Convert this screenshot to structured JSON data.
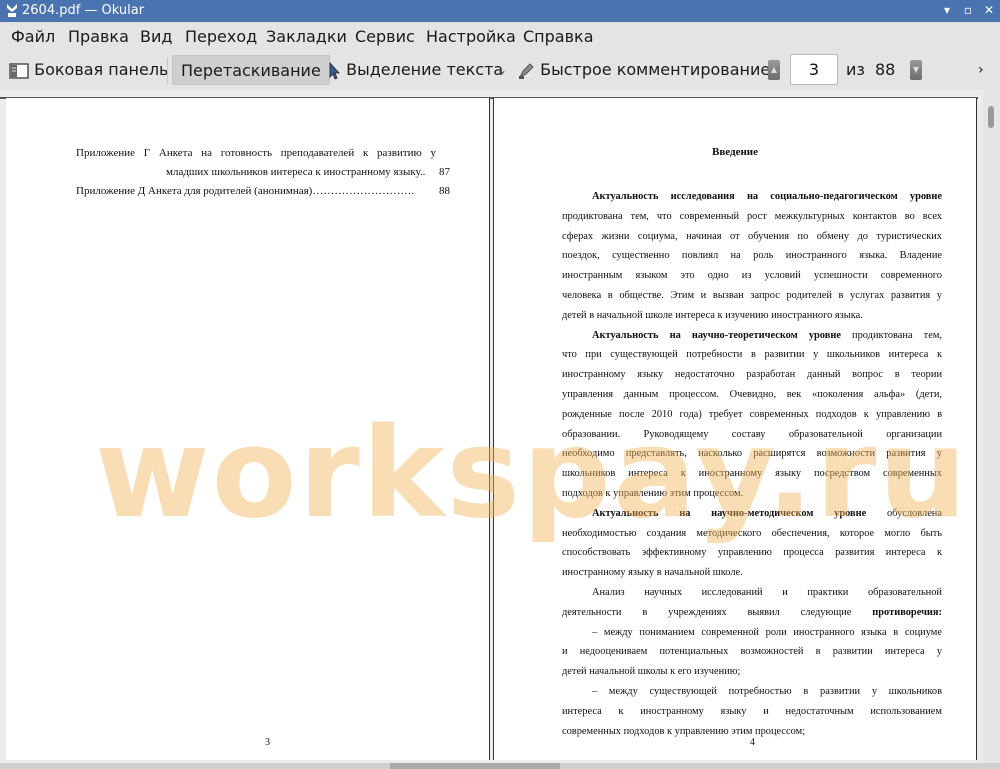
{
  "window": {
    "title": "2604.pdf — Okular"
  },
  "menu": [
    "Файл",
    "Правка",
    "Вид",
    "Переход",
    "Закладки",
    "Сервис",
    "Настройка",
    "Справка"
  ],
  "toolbar": {
    "sidebar_label": "Боковая панель",
    "drag_label": "Перетаскивание",
    "select_label": "Выделение текста",
    "annotate_label": "Быстрое комментирование",
    "page_current": "3",
    "of_label": "из",
    "page_total": "88"
  },
  "left_page": {
    "toc": [
      {
        "line1": "Приложение Г Анкета на готовность преподавателей к развитию у",
        "line2": "младших школьников интереса к иностранному языку..",
        "page": "87"
      },
      {
        "line1": "Приложение Д Анкета для родителей (анонимная)……………………….",
        "page": "88"
      }
    ],
    "page_number": "3"
  },
  "right_page": {
    "heading": "Введение",
    "lines": [
      {
        "bold": "Актуальность исследования на социально-педагогическом уровне",
        "text": ""
      },
      {
        "text": "продиктована тем, что современный рост межкультурных контактов во всех"
      },
      {
        "text": "сферах жизни социума, начиная от обучения по обмену до туристических"
      },
      {
        "text": "поездок, существенно повлиял на роль иностранного языка. Владение"
      },
      {
        "text": "иностранным языком это одно из условий успешности современного"
      },
      {
        "text": "человека в обществе. Этим и вызван запрос родителей в услугах развития у"
      },
      {
        "text": "детей в начальной школе интереса к изучению иностранного языка."
      },
      {
        "bold": "Актуальность на научно-теоретическом уровне",
        "text": " продиктована тем,"
      },
      {
        "text": "что при существующей потребности в развитии у школьников интереса к"
      },
      {
        "text": "иностранному языку недостаточно разработан данный вопрос в теории"
      },
      {
        "text": "управления данным процессом. Очевидно, век «поколения альфа» (дети,"
      },
      {
        "text": "рожденные после 2010 года) требует современных подходов к управлению в"
      },
      {
        "text": "образовании. Руководящему составу образовательной организации"
      },
      {
        "text": "необходимо представлять, насколько расширятся возможности развития у"
      },
      {
        "text": "школьников интереса к иностранному языку посредством современных"
      },
      {
        "text": "подходов к управлению этим процессом."
      },
      {
        "bold": "Актуальность на научно-методическом уровне",
        "text": " обусловлена"
      },
      {
        "text": "необходимостью создания методического обеспечения, которое могло быть"
      },
      {
        "text": "способствовать эффективному управлению процесса развития интереса к"
      },
      {
        "text": "иностранному языку в начальной школе."
      },
      {
        "text": "Анализ научных исследований и практики образовательной"
      },
      {
        "text": "деятельности в учреждениях выявил следующие ",
        "bold_end": "противоречия:"
      },
      {
        "text": "– между пониманием современной роли иностранного языка в социуме"
      },
      {
        "text": "и недооцениваем потенциальных возможностей в развитии интереса у"
      },
      {
        "text": "детей начальной школы к его изучению;"
      },
      {
        "text": "– между существующей потребностью в развитии у школьников"
      },
      {
        "text": "интереса к иностранному языку и недостаточным использованием"
      },
      {
        "text": "современных подходов к управлению этим процессом;"
      }
    ],
    "page_number": "4"
  },
  "watermark": "workspay.ru",
  "colors": {
    "titlebar": "#4a74b0",
    "watermark": "#f2b45a"
  }
}
